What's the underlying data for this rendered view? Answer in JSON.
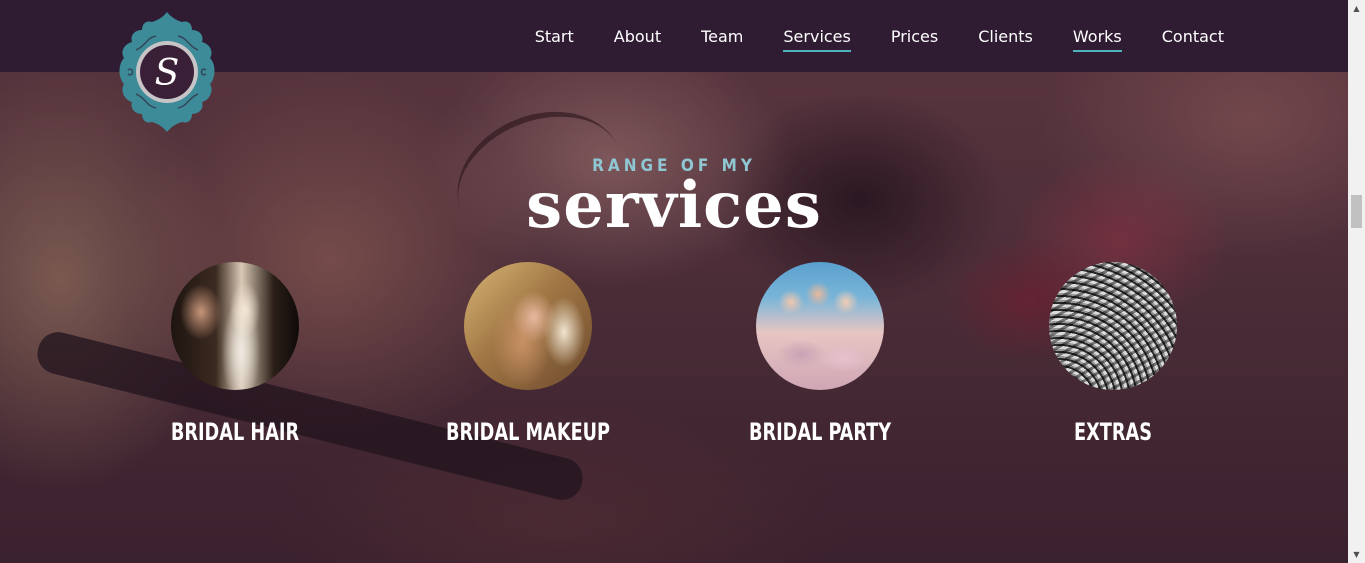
{
  "nav": {
    "items": [
      {
        "label": "Start"
      },
      {
        "label": "About"
      },
      {
        "label": "Team"
      },
      {
        "label": "Services"
      },
      {
        "label": "Prices"
      },
      {
        "label": "Clients"
      },
      {
        "label": "Works"
      },
      {
        "label": "Contact"
      }
    ],
    "active_items": [
      "Services",
      "Works"
    ],
    "accent_color": "#4fb3bf",
    "background_color": "#2f1c33"
  },
  "logo": {
    "letter": "S",
    "frame_color": "#3d8a98"
  },
  "heading": {
    "kicker": "RANGE OF MY",
    "title": "services",
    "kicker_color": "#8fc7d2"
  },
  "services": [
    {
      "label": "BRIDAL HAIR",
      "image": "bridal-hair-photo"
    },
    {
      "label": "BRIDAL MAKEUP",
      "image": "bridal-makeup-photo"
    },
    {
      "label": "BRIDAL PARTY",
      "image": "bridal-party-photo"
    },
    {
      "label": "EXTRAS",
      "image": "eyelashes-photo"
    }
  ],
  "scrollbar": {
    "up_icon": "triangle-up-icon",
    "down_icon": "triangle-down-icon"
  }
}
